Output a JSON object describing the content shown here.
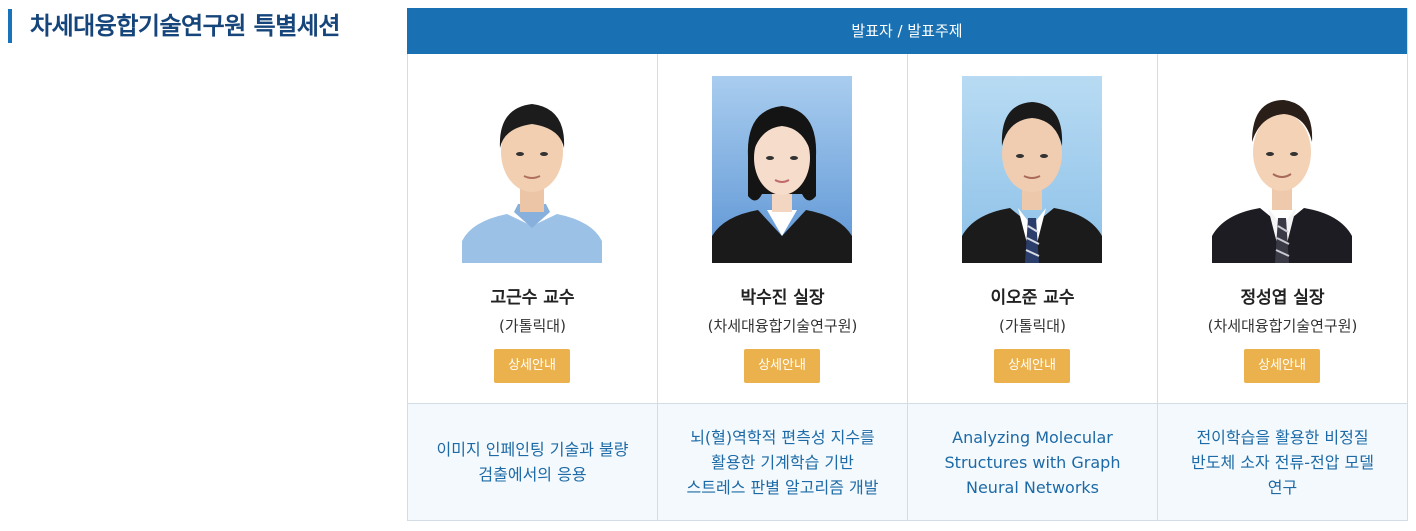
{
  "page": {
    "title": "차세대융합기술연구원 특별세션"
  },
  "table": {
    "header": "발표자 / 발표주제"
  },
  "presenters": [
    {
      "name": "고근수 교수",
      "affiliation": "(가톨릭대)",
      "button_label": "상세안내",
      "topic_lines": [
        "이미지 인페인팅 기술과 불량",
        "검출에서의 응용"
      ]
    },
    {
      "name": "박수진 실장",
      "affiliation": "(차세대융합기술연구원)",
      "button_label": "상세안내",
      "topic_lines": [
        "뇌(혈)역학적 편측성 지수를",
        "활용한 기계학습 기반",
        "스트레스 판별 알고리즘 개발"
      ]
    },
    {
      "name": "이오준 교수",
      "affiliation": "(가톨릭대)",
      "button_label": "상세안내",
      "topic_lines": [
        "Analyzing Molecular",
        "Structures with Graph",
        "Neural Networks"
      ]
    },
    {
      "name": "정성엽 실장",
      "affiliation": "(차세대융합기술연구원)",
      "button_label": "상세안내",
      "topic_lines": [
        "전이학습을 활용한 비정질",
        "반도체 소자 전류-전압 모델",
        "연구"
      ]
    }
  ],
  "colors": {
    "header_bg": "#1971b4",
    "title_text": "#15457a",
    "button_bg": "#ebb14d",
    "topic_text": "#1d6aa6",
    "topic_bg": "#f3f9fd"
  }
}
